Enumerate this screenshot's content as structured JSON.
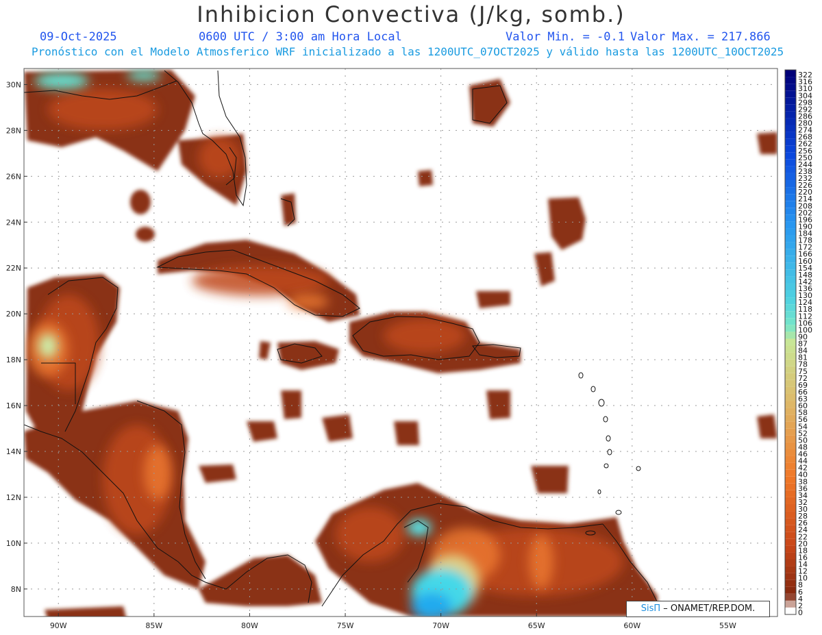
{
  "title": "Inhibicion Convectiva (J/kg, somb.)",
  "date": "09-Oct-2025",
  "time": "0600 UTC / 3:00 am Hora Local",
  "valor_min_label": "Valor Min. = -0.1",
  "valor_max_label": "Valor Max. = 217.866",
  "forecast_line": "Pronóstico con el Modelo Atmosferico WRF inicializado a las 1200UTC_07OCT2025 y válido hasta las  1200UTC_10OCT2025",
  "credit": {
    "brand": "SisΠ",
    "rest": " – ONAMET/REP.DOM."
  },
  "lat_labels": [
    "30N",
    "28N",
    "26N",
    "24N",
    "22N",
    "20N",
    "18N",
    "16N",
    "14N",
    "12N",
    "10N",
    "8N"
  ],
  "lon_labels": [
    "90W",
    "85W",
    "80W",
    "75W",
    "70W",
    "65W",
    "60W",
    "55W"
  ],
  "colorbar": {
    "levels": [
      "322",
      "316",
      "310",
      "304",
      "298",
      "292",
      "286",
      "280",
      "274",
      "268",
      "262",
      "256",
      "250",
      "244",
      "238",
      "232",
      "226",
      "220",
      "214",
      "208",
      "202",
      "196",
      "190",
      "184",
      "178",
      "172",
      "166",
      "160",
      "154",
      "148",
      "142",
      "136",
      "130",
      "124",
      "118",
      "112",
      "106",
      "100",
      "90",
      "87",
      "84",
      "81",
      "78",
      "75",
      "72",
      "69",
      "66",
      "63",
      "60",
      "58",
      "56",
      "54",
      "52",
      "50",
      "48",
      "46",
      "44",
      "42",
      "40",
      "38",
      "36",
      "34",
      "32",
      "30",
      "28",
      "26",
      "24",
      "22",
      "20",
      "18",
      "16",
      "14",
      "12",
      "10",
      "8",
      "6",
      "4",
      "2",
      "0"
    ]
  },
  "colors": {
    "title": "#333333",
    "info": "#2255ee",
    "forecast": "#1a9be0",
    "field_dark": "#7a2a12",
    "field_mid": "#b84418",
    "field_high": "#ee7a33",
    "cyan": "#44ddee"
  }
}
